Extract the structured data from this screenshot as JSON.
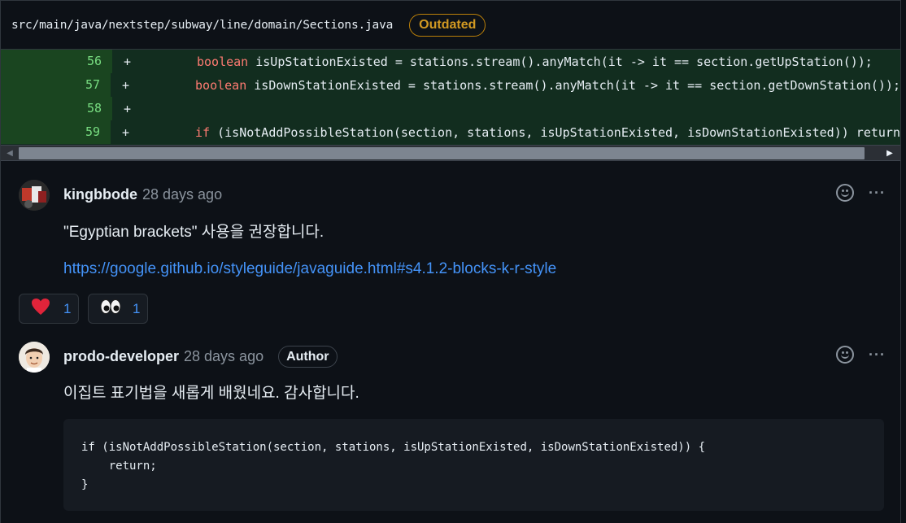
{
  "file": {
    "path": "src/main/java/nextstep/subway/line/domain/Sections.java",
    "badge": "Outdated"
  },
  "diff": {
    "lines": [
      {
        "no": "56",
        "marker": "+",
        "pre": "",
        "kw": "boolean",
        "code": " isUpStationExisted = stations.stream().anyMatch(it -> it == section.getUpStation());"
      },
      {
        "no": "57",
        "marker": "+",
        "pre": "",
        "kw": "boolean",
        "code": " isDownStationExisted = stations.stream().anyMatch(it -> it == section.getDownStation());"
      },
      {
        "no": "58",
        "marker": "+",
        "pre": "",
        "kw": "",
        "code": ""
      },
      {
        "no": "59",
        "marker": "+",
        "pre": "",
        "kw": "if",
        "code": " (isNotAddPossibleStation(section, stations, isUpStationExisted, isDownStationExisted)) return"
      }
    ]
  },
  "comments": [
    {
      "author": "kingbbode",
      "time": "28 days ago",
      "text": "\"Egyptian brackets\" 사용을 권장합니다.",
      "link": "https://google.github.io/styleguide/javaguide.html#s4.1.2-blocks-k-r-style",
      "reactions": [
        {
          "icon": "heart-icon",
          "emoji": "❤️",
          "count": "1"
        },
        {
          "icon": "eyes-icon",
          "emoji": "👀",
          "count": "1"
        }
      ]
    },
    {
      "author": "prodo-developer",
      "time": "28 days ago",
      "badge": "Author",
      "text": "이집트 표기법을 새롭게 배웠네요. 감사합니다.",
      "code": "if (isNotAddPossibleStation(section, stations, isUpStationExisted, isDownStationExisted)) {\n    return;\n}"
    }
  ],
  "actions": {
    "more": "···"
  },
  "colors": {
    "background": "#0d1117",
    "diff_added_bg": "#122d1f",
    "line_number_bg": "#1b4721",
    "link": "#4493f8",
    "outdated": "#d29922"
  }
}
